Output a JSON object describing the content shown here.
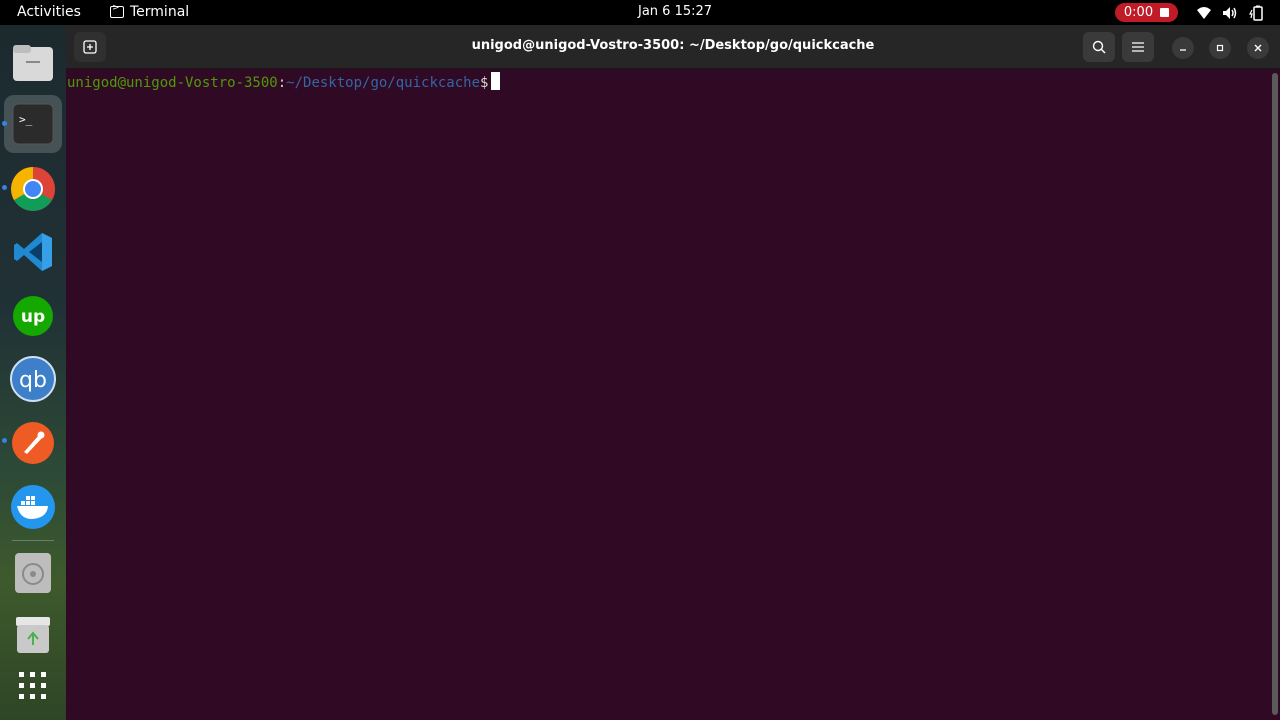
{
  "topbar": {
    "activities": "Activities",
    "app_name": "Terminal",
    "clock": "Jan 6  15:27",
    "recording_time": "0:00",
    "icons": [
      "wifi-icon",
      "volume-icon",
      "battery-icon"
    ]
  },
  "dock": {
    "items": [
      {
        "name": "files-app",
        "icon": "files-icon"
      },
      {
        "name": "terminal-app",
        "icon": "terminal-icon",
        "glyph": ">_"
      },
      {
        "name": "chrome-app",
        "icon": "chrome-icon"
      },
      {
        "name": "vscode-app",
        "icon": "vscode-icon"
      },
      {
        "name": "upwork-app",
        "icon": "upwork-icon",
        "glyph": "up"
      },
      {
        "name": "qbittorrent-app",
        "icon": "qbittorrent-icon",
        "glyph": "qb"
      },
      {
        "name": "postman-app",
        "icon": "postman-icon"
      },
      {
        "name": "docker-app",
        "icon": "docker-icon"
      },
      {
        "name": "disc-app",
        "icon": "disc-icon"
      },
      {
        "name": "trash-app",
        "icon": "trash-icon"
      },
      {
        "name": "show-apps",
        "icon": "grid-icon"
      }
    ]
  },
  "window": {
    "title": "unigod@unigod-Vostro-3500: ~/Desktop/go/quickcache",
    "prompt_user": "unigod@unigod-Vostro-3500",
    "prompt_colon": ":",
    "prompt_path": "~/Desktop/go/quickcache",
    "prompt_symbol": "$"
  },
  "colors": {
    "terminal_bg": "#300a24",
    "prompt_user": "#4e9a06",
    "prompt_path": "#3465a4",
    "record_red": "#c01c28"
  }
}
